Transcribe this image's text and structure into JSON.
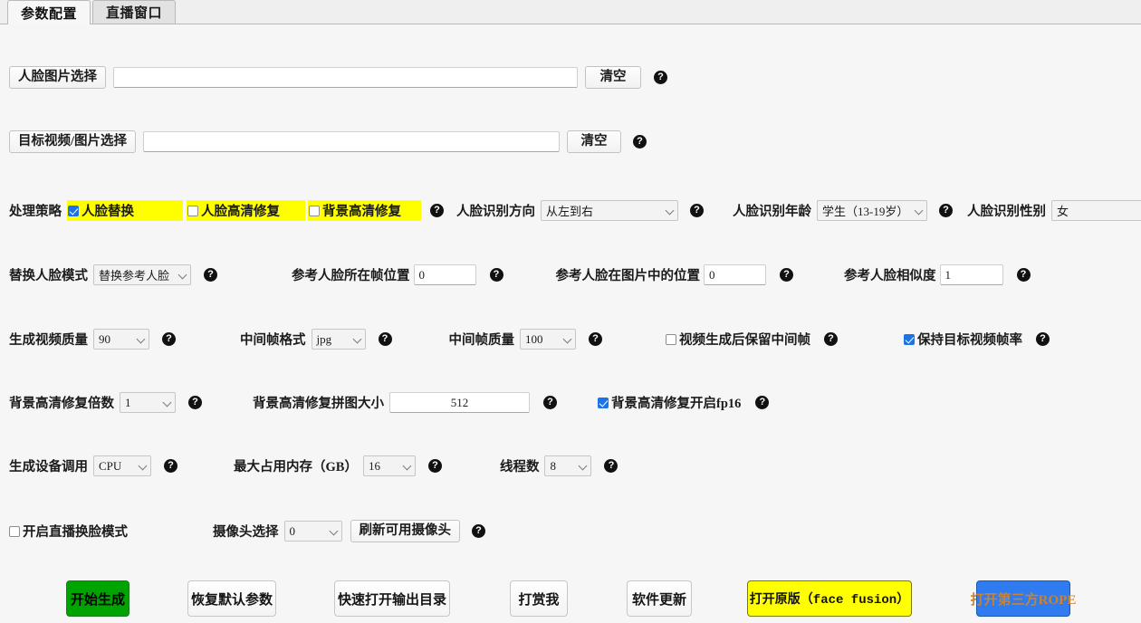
{
  "tabs": [
    {
      "label": "参数配置",
      "active": true
    },
    {
      "label": "直播窗口",
      "active": false
    }
  ],
  "rows": {
    "face_image": {
      "button_label": "人脸图片选择",
      "input_value": "",
      "clear_label": "清空",
      "help": "?"
    },
    "target_media": {
      "button_label": "目标视频/图片选择",
      "input_value": "",
      "clear_label": "清空",
      "help": "?"
    },
    "strategy": {
      "label": "处理策略",
      "checks": [
        {
          "label": "人脸替换",
          "checked": true
        },
        {
          "label": "人脸高清修复",
          "checked": false
        },
        {
          "label": "背景高清修复",
          "checked": false
        }
      ],
      "help": "?",
      "direction_label": "人脸识别方向",
      "direction_value": "从左到右",
      "direction_help": "?",
      "age_label": "人脸识别年龄",
      "age_value": "学生（13-19岁）",
      "age_help": "?",
      "gender_label": "人脸识别性别",
      "gender_value": "女",
      "gender_help": "?"
    },
    "reference": {
      "mode_label": "替换人脸模式",
      "mode_value": "替换参考人脸",
      "mode_help": "?",
      "frame_label": "参考人脸所在帧位置",
      "frame_value": "0",
      "frame_help": "?",
      "pos_label": "参考人脸在图片中的位置",
      "pos_value": "0",
      "pos_help": "?",
      "sim_label": "参考人脸相似度",
      "sim_value": "1",
      "sim_help": "?"
    },
    "quality": {
      "video_quality_label": "生成视频质量",
      "video_quality_value": "90",
      "video_quality_help": "?",
      "frame_format_label": "中间帧格式",
      "frame_format_value": "jpg",
      "frame_format_help": "?",
      "frame_quality_label": "中间帧质量",
      "frame_quality_value": "100",
      "frame_quality_help": "?",
      "keep_frames_label": "视频生成后保留中间帧",
      "keep_frames_checked": false,
      "keep_frames_help": "?",
      "keep_fps_label": "保持目标视频帧率",
      "keep_fps_checked": true,
      "keep_fps_help": "?"
    },
    "background": {
      "scale_label": "背景高清修复倍数",
      "scale_value": "1",
      "scale_help": "?",
      "tile_label": "背景高清修复拼图大小",
      "tile_value": "512",
      "tile_help": "?",
      "fp16_label": "背景高清修复开启fp16",
      "fp16_checked": true,
      "fp16_help": "?"
    },
    "device": {
      "device_label": "生成设备调用",
      "device_value": "CPU",
      "device_help": "?",
      "memory_label": "最大占用内存（GB）",
      "memory_value": "16",
      "memory_help": "?",
      "threads_label": "线程数",
      "threads_value": "8",
      "threads_help": "?"
    },
    "live": {
      "enable_label": "开启直播换脸模式",
      "enable_checked": false,
      "camera_label": "摄像头选择",
      "camera_value": "0",
      "refresh_label": "刷新可用摄像头",
      "help": "?"
    }
  },
  "actions": [
    {
      "label": "开始生成",
      "style": "green"
    },
    {
      "label": "恢复默认参数",
      "style": "plain"
    },
    {
      "label": "快速打开输出目录",
      "style": "plain"
    },
    {
      "label": "打赏我",
      "style": "plain"
    },
    {
      "label": "软件更新",
      "style": "plain"
    },
    {
      "label": "打开原版（face fusion）",
      "style": "yellow"
    },
    {
      "label": "打开第三方ROPE",
      "style": "blue"
    }
  ],
  "colors": {
    "highlight": "#ffff00",
    "checkbox_on": "#1a73e8",
    "start_button": "#00a400",
    "rope_button": "#2f7bef",
    "rope_text": "#c98432"
  }
}
